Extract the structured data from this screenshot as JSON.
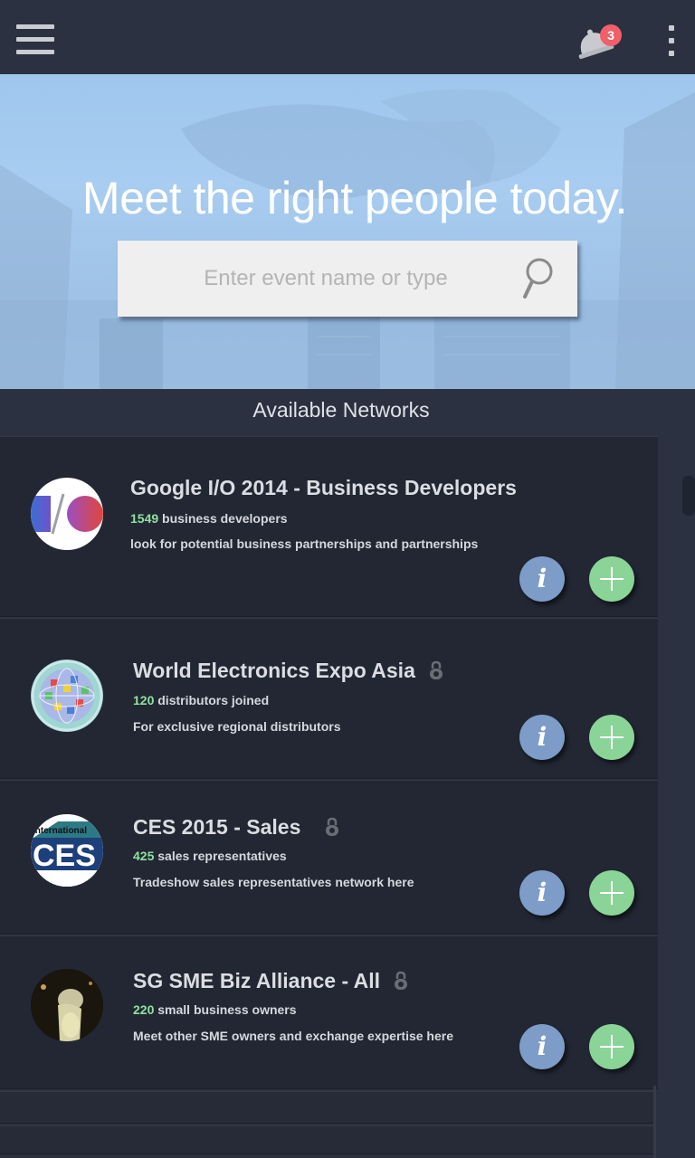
{
  "appbar": {
    "notification_count": "3",
    "icons": [
      "menu-icon",
      "bell-icon",
      "overflow-menu-icon"
    ]
  },
  "hero": {
    "title": "Meet the right people today.",
    "search": {
      "placeholder": "Enter event name or type",
      "value": ""
    }
  },
  "networks": {
    "heading": "Available Networks",
    "items": [
      {
        "title": "Google I/O 2014 - Business Developers",
        "count": "1549",
        "count_label": "business developers",
        "description": "look for potential business partnerships and partnerships",
        "locked": false,
        "info_label": "i"
      },
      {
        "title": "World Electronics Expo Asia",
        "count": "120",
        "count_label": "distributors joined",
        "description": "For exclusive regional distributors",
        "locked": true,
        "info_label": "i"
      },
      {
        "title": "CES 2015 - Sales",
        "count": "425",
        "count_label": "sales representatives",
        "description": "Tradeshow sales representatives network here",
        "locked": true,
        "info_label": "i",
        "logo_text": [
          "International",
          "CES"
        ]
      },
      {
        "title": "SG SME Biz Alliance - All",
        "count": "220",
        "count_label": "small business owners",
        "description": "Meet other SME owners and exchange expertise here",
        "locked": true,
        "info_label": "i"
      }
    ]
  },
  "colors": {
    "background": "#2b3140",
    "card": "#222733",
    "count_accent": "#8fe0a0",
    "info_button": "#7d9cc7",
    "add_button": "#8ad497",
    "badge": "#f0606a"
  }
}
